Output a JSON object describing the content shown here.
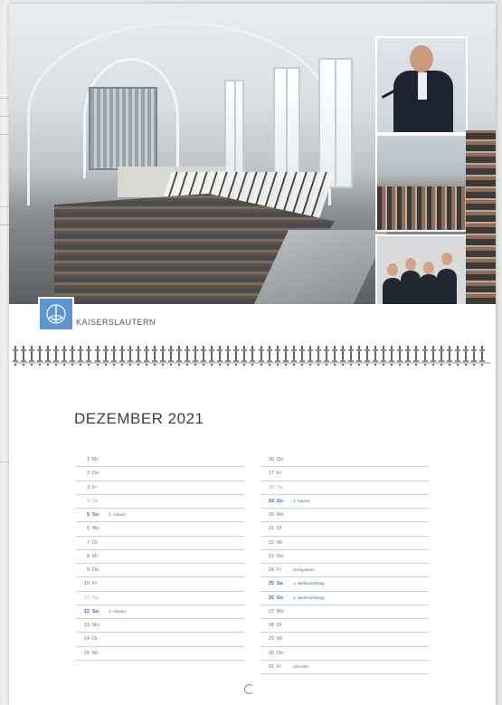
{
  "calendar": {
    "location": "KAISERSLAUTERN",
    "title": "DEZEMBER 2021",
    "days_left": [
      {
        "num": "1",
        "dow": "Mi",
        "note": "",
        "type": "weekday"
      },
      {
        "num": "2",
        "dow": "Do",
        "note": "",
        "type": "weekday"
      },
      {
        "num": "3",
        "dow": "Fr",
        "note": "",
        "type": "weekday"
      },
      {
        "num": "4",
        "dow": "Sa",
        "note": "",
        "type": "sat"
      },
      {
        "num": "5",
        "dow": "So",
        "note": "2. Advent",
        "type": "sun"
      },
      {
        "num": "6",
        "dow": "Mo",
        "note": "",
        "type": "weekday"
      },
      {
        "num": "7",
        "dow": "Di",
        "note": "",
        "type": "weekday"
      },
      {
        "num": "8",
        "dow": "Mi",
        "note": "",
        "type": "weekday"
      },
      {
        "num": "9",
        "dow": "Do",
        "note": "",
        "type": "weekday"
      },
      {
        "num": "10",
        "dow": "Fr",
        "note": "",
        "type": "weekday"
      },
      {
        "num": "11",
        "dow": "Sa",
        "note": "",
        "type": "sat"
      },
      {
        "num": "12",
        "dow": "So",
        "note": "3. Advent",
        "type": "sun"
      },
      {
        "num": "13",
        "dow": "Mo",
        "note": "",
        "type": "weekday"
      },
      {
        "num": "14",
        "dow": "Di",
        "note": "",
        "type": "weekday"
      },
      {
        "num": "15",
        "dow": "Mi",
        "note": "",
        "type": "weekday"
      }
    ],
    "days_right": [
      {
        "num": "16",
        "dow": "Do",
        "note": "",
        "type": "weekday"
      },
      {
        "num": "17",
        "dow": "Fr",
        "note": "",
        "type": "weekday"
      },
      {
        "num": "18",
        "dow": "Sa",
        "note": "",
        "type": "sat"
      },
      {
        "num": "19",
        "dow": "So",
        "note": "4. Advent",
        "type": "sun"
      },
      {
        "num": "20",
        "dow": "Mo",
        "note": "",
        "type": "weekday"
      },
      {
        "num": "21",
        "dow": "Di",
        "note": "",
        "type": "weekday"
      },
      {
        "num": "22",
        "dow": "Mi",
        "note": "",
        "type": "weekday"
      },
      {
        "num": "23",
        "dow": "Do",
        "note": "",
        "type": "weekday"
      },
      {
        "num": "24",
        "dow": "Fr",
        "note": "Heiligabend",
        "type": "weekday"
      },
      {
        "num": "25",
        "dow": "Sa",
        "note": "1. Weihnachtstag",
        "type": "sun"
      },
      {
        "num": "26",
        "dow": "So",
        "note": "2. Weihnachtstag",
        "type": "sun"
      },
      {
        "num": "27",
        "dow": "Mo",
        "note": "",
        "type": "weekday"
      },
      {
        "num": "28",
        "dow": "Di",
        "note": "",
        "type": "weekday"
      },
      {
        "num": "29",
        "dow": "Mi",
        "note": "",
        "type": "weekday"
      },
      {
        "num": "30",
        "dow": "Do",
        "note": "",
        "type": "weekday"
      },
      {
        "num": "31",
        "dow": "Fr",
        "note": "Silvester",
        "type": "weekday"
      }
    ]
  },
  "colors": {
    "logo_blue": "#5e95cf",
    "sunday_blue": "#3e6fb5",
    "saturday_grey_blue": "#a4b1c3",
    "row_rule": "#c9d3dd"
  },
  "icons": {
    "logo": "church-emblem-icon",
    "binding": "spiral-binding-icon",
    "hanger": "hanging-hook-icon"
  }
}
